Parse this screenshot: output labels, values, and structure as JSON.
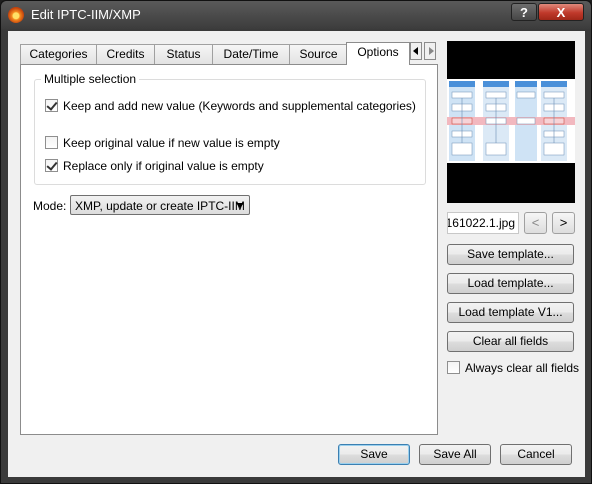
{
  "window": {
    "title": "Edit IPTC-IIM/XMP"
  },
  "titlebar": {
    "help_label": "?",
    "close_label": "X"
  },
  "tabs": [
    {
      "label": "Categories"
    },
    {
      "label": "Credits"
    },
    {
      "label": "Status"
    },
    {
      "label": "Date/Time"
    },
    {
      "label": "Source"
    },
    {
      "label": "Options",
      "active": true
    }
  ],
  "options": {
    "group_title": "Multiple selection",
    "checkboxes": [
      {
        "label": "Keep and add new value (Keywords and supplemental categories)",
        "checked": true
      },
      {
        "label": "Keep original value if new value is empty",
        "checked": false
      },
      {
        "label": "Replace only if original value is empty",
        "checked": true
      }
    ],
    "mode_label": "Mode:",
    "mode_value": "XMP, update or create IPTC-IIM"
  },
  "sidebar": {
    "filename": "161022.1.jpg",
    "prev_label": "<",
    "next_label": ">",
    "save_template": "Save template...",
    "load_template": "Load template...",
    "load_template_v1": "Load template V1...",
    "clear_all": "Clear all fields",
    "always_clear": {
      "label": "Always clear all fields",
      "checked": false
    }
  },
  "footer": {
    "save": "Save",
    "save_all": "Save All",
    "cancel": "Cancel"
  },
  "icons": {
    "app": "xnview-app-icon",
    "tab_scroll_left": "arrow-left-icon",
    "tab_scroll_right": "arrow-right-icon",
    "dropdown": "chevron-down-icon"
  }
}
